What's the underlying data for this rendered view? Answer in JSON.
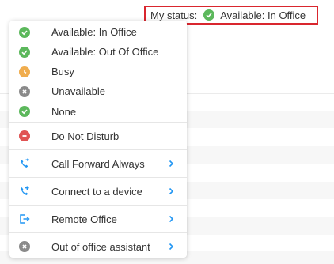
{
  "status": {
    "label": "My status:",
    "value": "Available: In Office",
    "icon": "check-circle-icon",
    "accent": "#d9262e"
  },
  "menu": {
    "presence_items": [
      {
        "label": "Available: In Office",
        "icon": "check-circle-icon",
        "color": "#5cb85c"
      },
      {
        "label": "Available: Out Of Office",
        "icon": "check-circle-icon",
        "color": "#5cb85c"
      },
      {
        "label": "Busy",
        "icon": "clock-circle-icon",
        "color": "#f0ad4e"
      },
      {
        "label": "Unavailable",
        "icon": "x-circle-icon",
        "color": "#8a8a8a"
      },
      {
        "label": "None",
        "icon": "check-circle-icon",
        "color": "#5cb85c"
      }
    ],
    "dnd": {
      "label": "Do Not Disturb",
      "icon": "minus-circle-icon",
      "color": "#e05353"
    },
    "call_forward": {
      "label": "Call Forward Always",
      "icon": "phone-forward-icon",
      "color": "#2196f3"
    },
    "connect": {
      "label": "Connect to a device",
      "icon": "phone-add-icon",
      "color": "#2196f3"
    },
    "remote_office": {
      "label": "Remote Office",
      "icon": "exit-icon",
      "color": "#2196f3"
    },
    "ooo_assistant": {
      "label": "Out of office assistant",
      "icon": "x-circle-icon",
      "color": "#8a8a8a"
    }
  }
}
